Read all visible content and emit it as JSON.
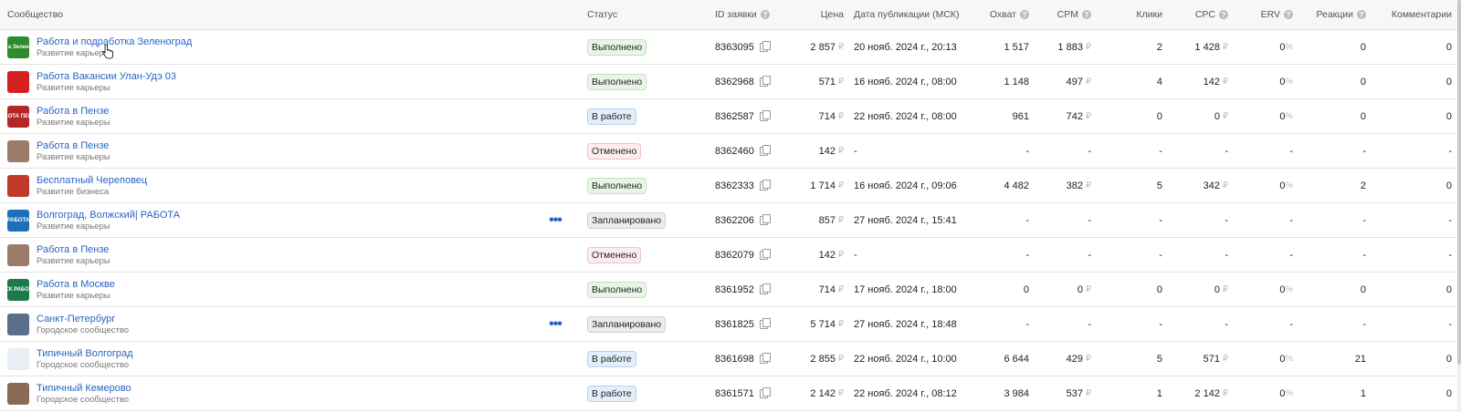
{
  "headers": {
    "community": "Сообщество",
    "status": "Статус",
    "id": "ID заявки",
    "price": "Цена",
    "date": "Дата публикации (МСК)",
    "reach": "Охват",
    "cpm": "CPM",
    "clicks": "Клики",
    "cpc": "CPC",
    "erv": "ERV",
    "reactions": "Реакции",
    "comments": "Комментарии"
  },
  "symbols": {
    "currency": "₽",
    "percent": "%",
    "more": "•••",
    "help": "?"
  },
  "rows": [
    {
      "name": "Работа и подработка Зеленоград",
      "category": "Развитие карьеры",
      "status": "Выполнено",
      "status_type": "done",
      "id": "8363095",
      "price": "2 857",
      "date": "20 нояб. 2024 г., 20:13",
      "reach": "1 517",
      "cpm": "1 883",
      "clicks": "2",
      "cpc": "1 428",
      "erv": "0",
      "reactions": "0",
      "comments": "0",
      "avatar_color": "#2e8b2e",
      "avatar_text": "Работа Зеленоград",
      "more": false
    },
    {
      "name": "Работа Вакансии Улан-Удэ 03",
      "category": "Развитие карьеры",
      "status": "Выполнено",
      "status_type": "done",
      "id": "8362968",
      "price": "571",
      "date": "16 нояб. 2024 г., 08:00",
      "reach": "1 148",
      "cpm": "497",
      "clicks": "4",
      "cpc": "142",
      "erv": "0",
      "reactions": "0",
      "comments": "0",
      "avatar_color": "#d42020",
      "avatar_text": "",
      "more": false
    },
    {
      "name": "Работа в Пензе",
      "category": "Развитие карьеры",
      "status": "В работе",
      "status_type": "work",
      "id": "8362587",
      "price": "714",
      "date": "22 нояб. 2024 г., 08:00",
      "reach": "961",
      "cpm": "742",
      "clicks": "0",
      "cpc": "0",
      "erv": "0",
      "reactions": "0",
      "comments": "0",
      "avatar_color": "#b52626",
      "avatar_text": "РАБОТА ПЕНЗА",
      "more": false
    },
    {
      "name": "Работа в Пензе",
      "category": "Развитие карьеры",
      "status": "Отменено",
      "status_type": "cancel",
      "id": "8362460",
      "price": "142",
      "date": "-",
      "reach": "-",
      "cpm": "-",
      "clicks": "-",
      "cpc": "-",
      "erv": "-",
      "reactions": "-",
      "comments": "-",
      "avatar_color": "#9c7b6a",
      "avatar_text": "",
      "more": false
    },
    {
      "name": "Бесплатный Череповец",
      "category": "Развитие бизнеса",
      "status": "Выполнено",
      "status_type": "done",
      "id": "8362333",
      "price": "1 714",
      "date": "16 нояб. 2024 г., 09:06",
      "reach": "4 482",
      "cpm": "382",
      "clicks": "5",
      "cpc": "342",
      "erv": "0",
      "reactions": "2",
      "comments": "0",
      "avatar_color": "#c0392b",
      "avatar_text": "",
      "more": false
    },
    {
      "name": "Волгоград, Волжский| РАБОТА",
      "category": "Развитие карьеры",
      "status": "Запланировано",
      "status_type": "plan",
      "id": "8362206",
      "price": "857",
      "date": "27 нояб. 2024 г., 15:41",
      "reach": "-",
      "cpm": "-",
      "clicks": "-",
      "cpc": "-",
      "erv": "-",
      "reactions": "-",
      "comments": "-",
      "avatar_color": "#1e6fb8",
      "avatar_text": "РАБОТА",
      "more": true
    },
    {
      "name": "Работа в Пензе",
      "category": "Развитие карьеры",
      "status": "Отменено",
      "status_type": "cancel",
      "id": "8362079",
      "price": "142",
      "date": "-",
      "reach": "-",
      "cpm": "-",
      "clicks": "-",
      "cpc": "-",
      "erv": "-",
      "reactions": "-",
      "comments": "-",
      "avatar_color": "#9c7b6a",
      "avatar_text": "",
      "more": false
    },
    {
      "name": "Работа в Москве",
      "category": "Развитие карьеры",
      "status": "Выполнено",
      "status_type": "done",
      "id": "8361952",
      "price": "714",
      "date": "17 нояб. 2024 г., 18:00",
      "reach": "0",
      "cpm": "0",
      "clicks": "0",
      "cpc": "0",
      "erv": "0",
      "reactions": "0",
      "comments": "0",
      "avatar_color": "#1b7a4a",
      "avatar_text": "МСК РАБОТА",
      "more": false
    },
    {
      "name": "Санкт-Петербург",
      "category": "Городское сообщество",
      "status": "Запланировано",
      "status_type": "plan",
      "id": "8361825",
      "price": "5 714",
      "date": "27 нояб. 2024 г., 18:48",
      "reach": "-",
      "cpm": "-",
      "clicks": "-",
      "cpc": "-",
      "erv": "-",
      "reactions": "-",
      "comments": "-",
      "avatar_color": "#5b6f8a",
      "avatar_text": "",
      "more": true
    },
    {
      "name": "Типичный Волгоград",
      "category": "Городское сообщество",
      "status": "В работе",
      "status_type": "work",
      "id": "8361698",
      "price": "2 855",
      "date": "22 нояб. 2024 г., 10:00",
      "reach": "6 644",
      "cpm": "429",
      "clicks": "5",
      "cpc": "571",
      "erv": "0",
      "reactions": "21",
      "comments": "0",
      "avatar_color": "#e9eef4",
      "avatar_text": "",
      "more": false
    },
    {
      "name": "Типичный Кемерово",
      "category": "Городское сообщество",
      "status": "В работе",
      "status_type": "work",
      "id": "8361571",
      "price": "2 142",
      "date": "22 нояб. 2024 г., 08:12",
      "reach": "3 984",
      "cpm": "537",
      "clicks": "1",
      "cpc": "2 142",
      "erv": "0",
      "reactions": "1",
      "comments": "0",
      "avatar_color": "#8a6a55",
      "avatar_text": "",
      "more": false
    }
  ]
}
